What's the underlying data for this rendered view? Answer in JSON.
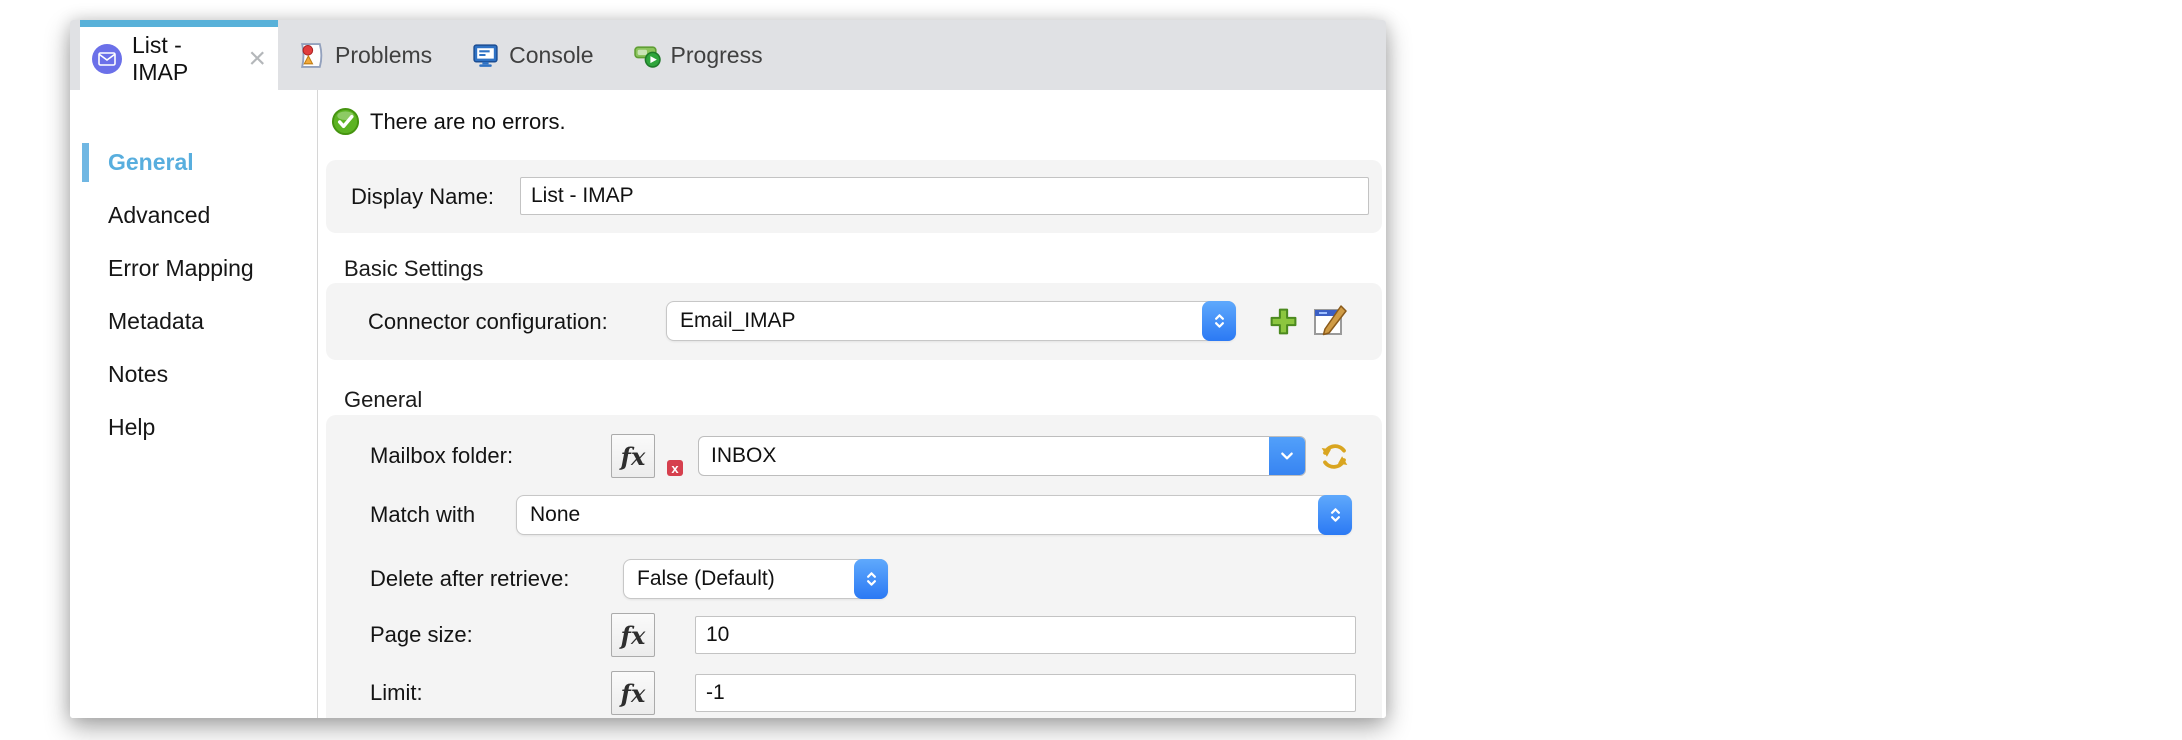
{
  "window": {
    "tabs": [
      {
        "label": "List - IMAP",
        "active": true,
        "close_label": "×",
        "icon": "email-icon"
      },
      {
        "label": "Problems",
        "icon": "problems-icon"
      },
      {
        "label": "Console",
        "icon": "console-icon"
      },
      {
        "label": "Progress",
        "icon": "progress-icon"
      }
    ]
  },
  "sidebar": {
    "items": [
      {
        "label": "General",
        "active": true
      },
      {
        "label": "Advanced"
      },
      {
        "label": "Error Mapping"
      },
      {
        "label": "Metadata"
      },
      {
        "label": "Notes"
      },
      {
        "label": "Help"
      }
    ]
  },
  "status": {
    "message": "There are no errors."
  },
  "form": {
    "display_name": {
      "label": "Display Name:",
      "value": "List - IMAP"
    },
    "basic_settings": {
      "title": "Basic Settings",
      "connector_configuration": {
        "label": "Connector configuration:",
        "value": "Email_IMAP"
      }
    },
    "general": {
      "title": "General",
      "mailbox_folder": {
        "label": "Mailbox folder:",
        "value": "INBOX",
        "fx_label": "fx",
        "error_badge": "x"
      },
      "match_with": {
        "label": "Match with",
        "value": "None"
      },
      "delete_after_retrieve": {
        "label": "Delete after retrieve:",
        "value": "False (Default)"
      },
      "page_size": {
        "label": "Page size:",
        "value": "10",
        "fx_label": "fx"
      },
      "limit": {
        "label": "Limit:",
        "value": "-1",
        "fx_label": "fx"
      }
    }
  },
  "icons": {
    "email": "email-icon",
    "problems": "problems-icon",
    "console": "console-icon",
    "progress": "progress-icon",
    "success": "success-check-icon",
    "fx": "fx-expression-icon",
    "error": "error-badge-icon",
    "spinner": "select-spinner-icon",
    "combo_arrow": "combo-dropdown-icon",
    "refresh": "refresh-icon",
    "add": "add-config-icon",
    "edit": "edit-config-icon",
    "close": "close-icon"
  },
  "colors": {
    "tab_accent": "#58b1d9",
    "sidebar_active": "#64b2e0",
    "select_blue": "#2f7ef8",
    "success_green": "#55a816",
    "error_red": "#d6404e",
    "add_green": "#8cc63f",
    "refresh_gold": "#d9a520",
    "tabbar_bg": "#e0e1e4",
    "box_bg": "#f4f4f4"
  }
}
